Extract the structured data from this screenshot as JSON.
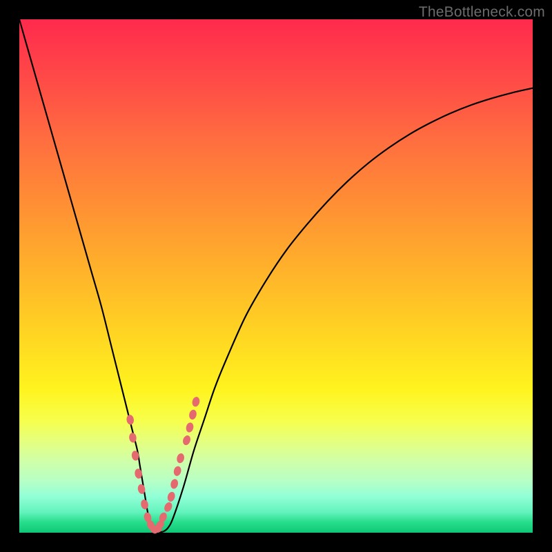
{
  "attribution": {
    "watermark": "TheBottleneck.com"
  },
  "chart_data": {
    "type": "line",
    "title": "",
    "xlabel": "",
    "ylabel": "",
    "xlim": [
      0,
      100
    ],
    "ylim": [
      0,
      100
    ],
    "grid": false,
    "x": [
      0,
      2,
      4,
      6,
      8,
      10,
      12,
      14,
      16,
      18,
      19,
      20,
      21,
      22,
      23,
      23.5,
      24,
      24.5,
      25,
      25.5,
      26,
      26.5,
      27,
      28,
      29,
      30,
      32,
      34,
      36,
      38,
      40,
      44,
      48,
      52,
      56,
      60,
      64,
      68,
      72,
      76,
      80,
      84,
      88,
      92,
      96,
      100
    ],
    "values": [
      100,
      93,
      86,
      79,
      72,
      65,
      58,
      51,
      44,
      36,
      32,
      28,
      24,
      20,
      16,
      13,
      10,
      7,
      4,
      2,
      1,
      0.5,
      0.2,
      0.2,
      1,
      3,
      9,
      16,
      22,
      28,
      33,
      42,
      49,
      55,
      60,
      64.5,
      68.5,
      72,
      75,
      77.6,
      79.8,
      81.7,
      83.3,
      84.6,
      85.7,
      86.6
    ],
    "markers": {
      "x": [
        21.6,
        22.1,
        22.6,
        23.2,
        23.8,
        24.4,
        25.0,
        25.6,
        26.2,
        26.8,
        27.4,
        28.0,
        29.0,
        29.6,
        30.2,
        30.8,
        31.4,
        32.6,
        33.2,
        33.8,
        34.4
      ],
      "y": [
        22.0,
        18.5,
        15.0,
        11.5,
        8.5,
        5.5,
        3.0,
        1.5,
        0.7,
        0.7,
        1.5,
        3.0,
        5.0,
        7.0,
        9.5,
        12.0,
        14.5,
        18.0,
        20.5,
        23.0,
        25.5
      ]
    },
    "colors": {
      "line": "#000000",
      "marker": "#e46a6f",
      "gradient_top": "#ff2a4d",
      "gradient_bottom": "#0fc877"
    }
  }
}
